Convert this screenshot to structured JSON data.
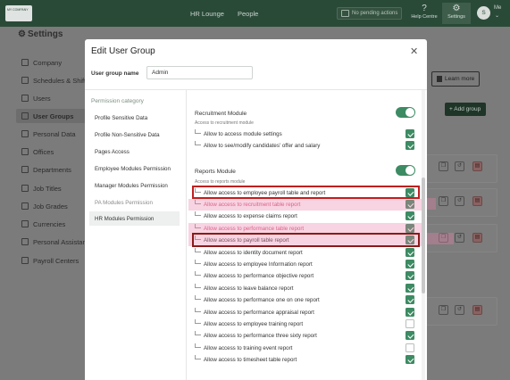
{
  "topbar": {
    "logo_text": "MY COMPANY",
    "nav": [
      "HR Lounge",
      "People"
    ],
    "pending_label": "No pending actions",
    "help_label": "Help Centre",
    "settings_label": "Settings",
    "avatar_initial": "S",
    "me_label": "Me"
  },
  "page": {
    "title": "Settings",
    "sidebar": [
      {
        "label": "Company"
      },
      {
        "label": "Schedules & Shifts"
      },
      {
        "label": "Users"
      },
      {
        "label": "User Groups"
      },
      {
        "label": "Personal Data"
      },
      {
        "label": "Offices"
      },
      {
        "label": "Departments"
      },
      {
        "label": "Job Titles"
      },
      {
        "label": "Job Grades"
      },
      {
        "label": "Currencies"
      },
      {
        "label": "Personal Assistant"
      },
      {
        "label": "Payroll Centers"
      }
    ],
    "learn_more": "Learn more",
    "add_group": "+ Add group"
  },
  "modal": {
    "title": "Edit User Group",
    "user_group_label": "User group name",
    "user_group_value": "Admin",
    "permission_category_title": "Permission category",
    "categories": [
      {
        "label": "Profile Sensitive Data"
      },
      {
        "label": "Profile Non-Sensitive Data"
      },
      {
        "label": "Pages Access"
      },
      {
        "label": "Employee Modules Permission"
      },
      {
        "label": "Manager Modules Permission"
      },
      {
        "label": "PA Modules Permission"
      },
      {
        "label": "HR Modules Permission"
      }
    ],
    "recruitment": {
      "title": "Recruitment Module",
      "subtitle": "Access to recruitment module",
      "enabled": true,
      "permissions": [
        {
          "label": "Allow to access module settings",
          "checked": true
        },
        {
          "label": "Allow to see/modify candidates' offer and salary",
          "checked": true
        }
      ]
    },
    "reports": {
      "title": "Reports Module",
      "subtitle": "Access to reports module",
      "enabled": true,
      "permissions": [
        {
          "label": "Allow access to employee payroll table and report",
          "checked": true
        },
        {
          "label": "Allow access to recruitment table report",
          "checked": true
        },
        {
          "label": "Allow access to expense claims report",
          "checked": true
        },
        {
          "label": "Allow access to performance table report",
          "checked": true
        },
        {
          "label": "Allow access to payroll table report",
          "checked": true
        },
        {
          "label": "Allow access to identity document report",
          "checked": true
        },
        {
          "label": "Allow access to employee Information report",
          "checked": true
        },
        {
          "label": "Allow access to performance objective report",
          "checked": true
        },
        {
          "label": "Allow access to leave balance report",
          "checked": true
        },
        {
          "label": "Allow access to performance one on one report",
          "checked": true
        },
        {
          "label": "Allow access to performance appraisal report",
          "checked": true
        },
        {
          "label": "Allow access to employee training report",
          "checked": false
        },
        {
          "label": "Allow access to performance three sixty report",
          "checked": true
        },
        {
          "label": "Allow access to training event report",
          "checked": false
        },
        {
          "label": "Allow access to timesheet table report",
          "checked": true
        }
      ]
    }
  },
  "colors": {
    "accent": "#3d8b63",
    "topbar": "#2a4a38",
    "highlight_red": "#c11f1f",
    "pink_text": "#d3517b"
  }
}
